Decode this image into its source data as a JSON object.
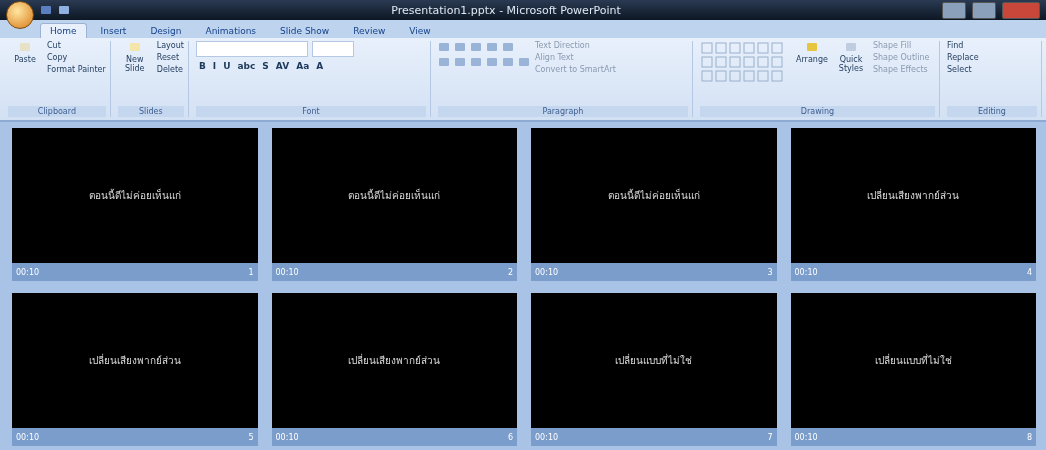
{
  "window": {
    "title": "Presentation1.pptx - Microsoft PowerPoint"
  },
  "tabs": [
    {
      "label": "Home",
      "selected": true
    },
    {
      "label": "Insert",
      "selected": false
    },
    {
      "label": "Design",
      "selected": false
    },
    {
      "label": "Animations",
      "selected": false
    },
    {
      "label": "Slide Show",
      "selected": false
    },
    {
      "label": "Review",
      "selected": false
    },
    {
      "label": "View",
      "selected": false
    }
  ],
  "clipboard": {
    "paste": "Paste",
    "items": [
      "Cut",
      "Copy",
      "Format Painter"
    ],
    "label": "Clipboard"
  },
  "slides_group": {
    "new_slide": "New Slide",
    "items": [
      "Layout",
      "Reset",
      "Delete"
    ],
    "label": "Slides"
  },
  "font": {
    "buttons": [
      "B",
      "I",
      "U",
      "abc",
      "S",
      "AV",
      "Aa",
      "A"
    ],
    "label": "Font"
  },
  "paragraph": {
    "items": [
      "Text Direction",
      "Align Text",
      "Convert to SmartArt"
    ],
    "label": "Paragraph"
  },
  "drawing": {
    "arrange": "Arrange",
    "quick_styles": "Quick Styles",
    "items": [
      "Shape Fill",
      "Shape Outline",
      "Shape Effects"
    ],
    "label": "Drawing"
  },
  "editing": {
    "items": [
      "Find",
      "Replace",
      "Select"
    ],
    "label": "Editing"
  },
  "slides": [
    {
      "title": "ตอนนี้ดีไม่ค่อยเห็นแก่",
      "timing": "00:10",
      "number": "1",
      "selected": false
    },
    {
      "title": "ตอนนี้ดีไม่ค่อยเห็นแก่",
      "timing": "00:10",
      "number": "2",
      "selected": false
    },
    {
      "title": "ตอนนี้ดีไม่ค่อยเห็นแก่",
      "timing": "00:10",
      "number": "3",
      "selected": false
    },
    {
      "title": "เปลี่ยนเสียงพากย์ส่วน",
      "timing": "00:10",
      "number": "4",
      "selected": false
    },
    {
      "title": "เปลี่ยนเสียงพากย์ส่วน",
      "timing": "00:10",
      "number": "5",
      "selected": false
    },
    {
      "title": "เปลี่ยนเสียงพากย์ส่วน",
      "timing": "00:10",
      "number": "6",
      "selected": false
    },
    {
      "title": "เปลี่ยนแบบที่ไม่ใช่",
      "timing": "00:10",
      "number": "7",
      "selected": false
    },
    {
      "title": "เปลี่ยนแบบที่ไม่ใช่",
      "timing": "00:10",
      "number": "8",
      "selected": false
    }
  ]
}
